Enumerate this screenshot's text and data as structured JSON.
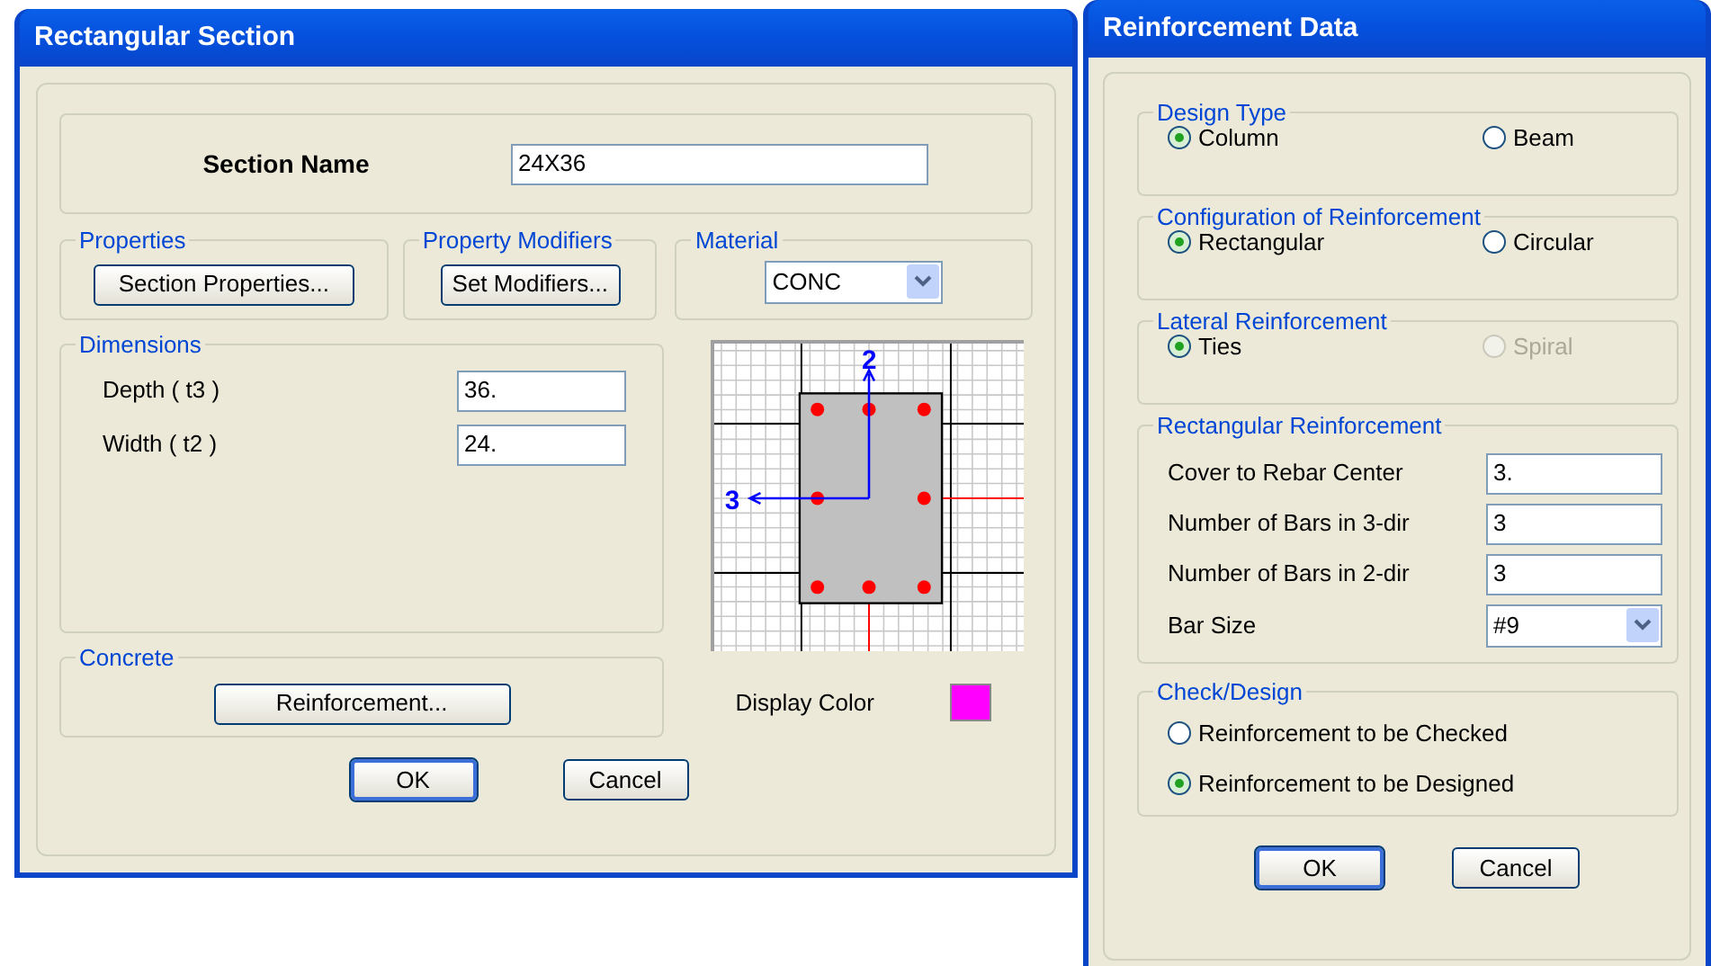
{
  "section_window": {
    "title": "Rectangular Section",
    "section_name": {
      "label": "Section Name",
      "value": "24X36"
    },
    "properties": {
      "legend": "Properties",
      "button": "Section Properties..."
    },
    "property_modifiers": {
      "legend": "Property Modifiers",
      "button": "Set Modifiers..."
    },
    "material": {
      "legend": "Material",
      "value": "CONC"
    },
    "dimensions": {
      "legend": "Dimensions",
      "fields": [
        {
          "label": "Depth ( t3 )",
          "value": "36."
        },
        {
          "label": "Width ( t2 )",
          "value": "24."
        }
      ]
    },
    "section_preview": {
      "axis_labels": [
        "2",
        "3"
      ]
    },
    "concrete": {
      "legend": "Concrete",
      "button": "Reinforcement..."
    },
    "display_color": {
      "label": "Display Color",
      "color": "#ff00ff"
    },
    "buttons": [
      {
        "label": "OK",
        "default": true
      },
      {
        "label": "Cancel",
        "default": false
      }
    ]
  },
  "reinforcement_window": {
    "title": "Reinforcement Data",
    "radio_groups": [
      {
        "legend": "Design Type",
        "options": [
          {
            "label": "Column",
            "selected": true,
            "disabled": false
          },
          {
            "label": "Beam",
            "selected": false,
            "disabled": false
          }
        ]
      },
      {
        "legend": "Configuration of Reinforcement",
        "options": [
          {
            "label": "Rectangular",
            "selected": true,
            "disabled": false
          },
          {
            "label": "Circular",
            "selected": false,
            "disabled": false
          }
        ]
      },
      {
        "legend": "Lateral Reinforcement",
        "options": [
          {
            "label": "Ties",
            "selected": true,
            "disabled": false
          },
          {
            "label": "Spiral",
            "selected": false,
            "disabled": true
          }
        ]
      }
    ],
    "rectangular_reinforcement": {
      "legend": "Rectangular Reinforcement",
      "fields": [
        {
          "kind": "text",
          "label": "Cover to Rebar Center",
          "value": "3."
        },
        {
          "kind": "text",
          "label": "Number of Bars in 3-dir",
          "value": "3"
        },
        {
          "kind": "text",
          "label": "Number of Bars in 2-dir",
          "value": "3"
        },
        {
          "kind": "select",
          "label": "Bar Size",
          "value": "#9"
        }
      ]
    },
    "check_design": {
      "legend": "Check/Design",
      "options": [
        {
          "label": "Reinforcement to be Checked",
          "selected": false
        },
        {
          "label": "Reinforcement to be Designed",
          "selected": true
        }
      ]
    },
    "buttons": [
      {
        "label": "OK",
        "default": true
      },
      {
        "label": "Cancel",
        "default": false
      }
    ]
  }
}
